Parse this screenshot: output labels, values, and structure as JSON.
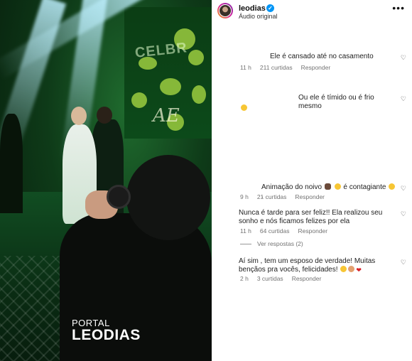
{
  "post": {
    "username": "leodias",
    "audio": "Áudio original",
    "watermark_top": "PORTAL",
    "watermark_main": "LEODIAS",
    "sign_text": "CELBR",
    "sign_initials": "AE"
  },
  "comments": [
    {
      "text": "Ele é cansado até no casamento",
      "time": "11 h",
      "likes": "211 curtidas",
      "reply": "Responder"
    },
    {
      "text": "Ou ele é tímido ou é frio mesmo",
      "time": "",
      "likes": "",
      "reply": ""
    },
    {
      "text_before": "Animação do noivo",
      "text_mid": "é contagiante",
      "time": "9 h",
      "likes": "21 curtidas",
      "reply": "Responder"
    },
    {
      "text": "Nunca é tarde para ser feliz!! Ela realizou seu sonho e nós ficamos felizes por ela",
      "time": "11 h",
      "likes": "64 curtidas",
      "reply": "Responder"
    },
    {
      "text": "Aí sim , tem um esposo de verdade! Muitas bençãos pra vocês, felicidades!",
      "time": "2 h",
      "likes": "3 curtidas",
      "reply": "Responder"
    }
  ],
  "replies_toggle": "Ver respostas (2)",
  "icons": {
    "like": "heart-outline-icon",
    "more": "more-options-icon",
    "verified": "verified-badge-icon"
  },
  "colors": {
    "verified": "#0095f6",
    "meta": "#737373"
  }
}
